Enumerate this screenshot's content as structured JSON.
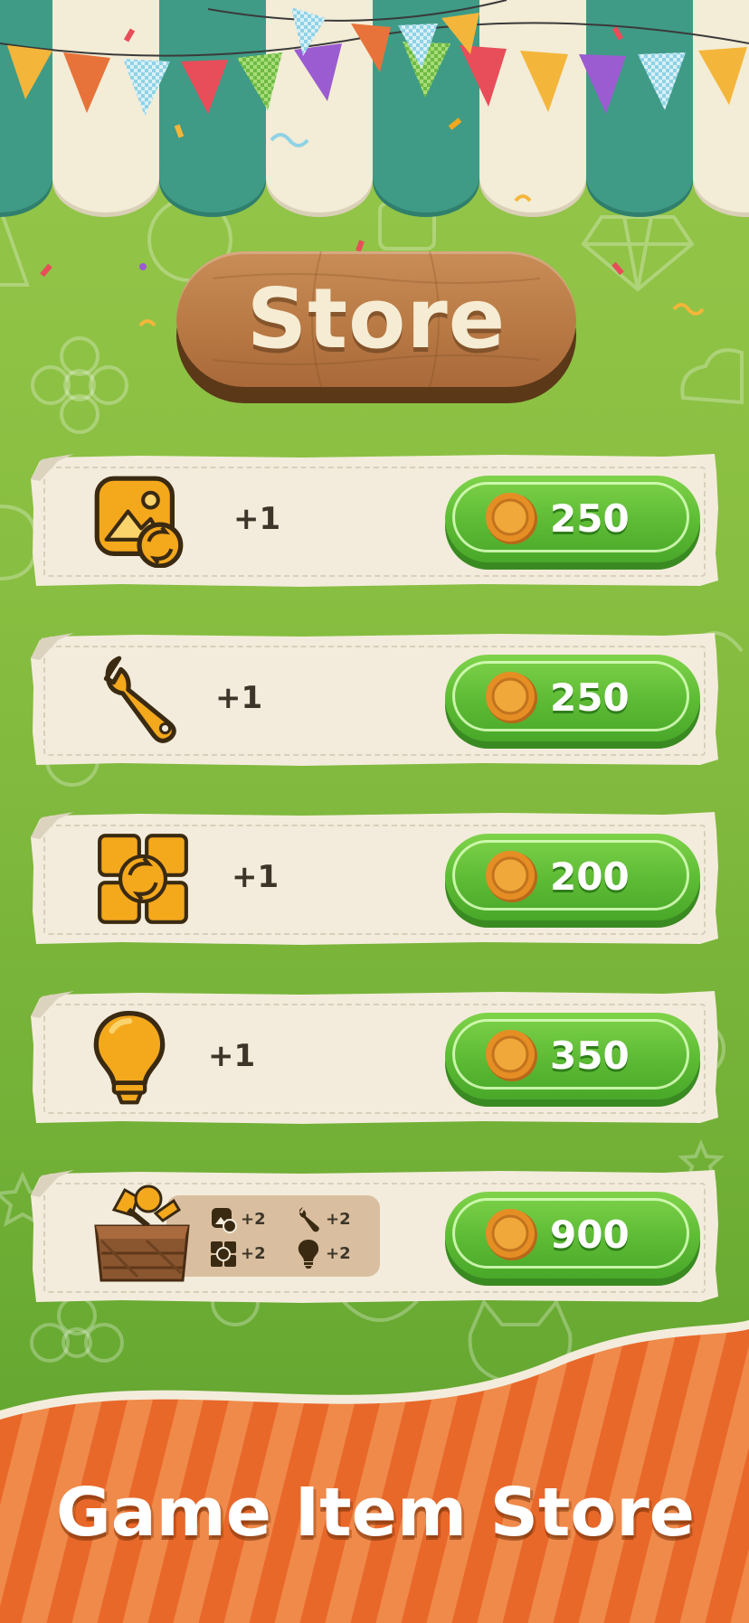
{
  "store": {
    "title": "Store"
  },
  "items": [
    {
      "icon": "image-swap-icon",
      "quantity": "+1",
      "price": "250"
    },
    {
      "icon": "wrench-icon",
      "quantity": "+1",
      "price": "250"
    },
    {
      "icon": "shuffle-tiles-icon",
      "quantity": "+1",
      "price": "200"
    },
    {
      "icon": "lightbulb-icon",
      "quantity": "+1",
      "price": "350"
    }
  ],
  "bundle": {
    "icon": "treasure-chest-icon",
    "contents": [
      {
        "icon": "image-swap-icon",
        "quantity": "+2"
      },
      {
        "icon": "wrench-icon",
        "quantity": "+2"
      },
      {
        "icon": "shuffle-tiles-icon",
        "quantity": "+2"
      },
      {
        "icon": "lightbulb-icon",
        "quantity": "+2"
      }
    ],
    "price": "900"
  },
  "currency_icon": "gold-coin-icon",
  "banner": {
    "text": "Game Item Store"
  },
  "colors": {
    "background_green": "#86bd40",
    "button_green": "#5cba34",
    "wood_brown": "#b97a45",
    "icon_gold": "#f4a81c",
    "banner_orange": "#ea6a2c",
    "awning_teal": "#3f9b86",
    "awning_cream": "#f3ecd6"
  }
}
